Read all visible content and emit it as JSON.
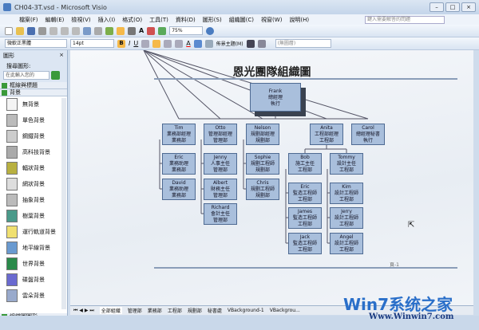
{
  "window": {
    "title": "CH04-3T.vsd - Microsoft Visio"
  },
  "menu": [
    "檔案(F)",
    "編輯(E)",
    "檢視(V)",
    "插入(I)",
    "格式(O)",
    "工具(T)",
    "資料(D)",
    "圖形(S)",
    "組織圖(C)",
    "視窗(W)",
    "說明(H)"
  ],
  "search": {
    "placeholder": "鍵入需要解答的問題"
  },
  "toolbar": {
    "zoom": "75%",
    "font": "微軟正黑體",
    "size": "14pt",
    "theme_label": "佈景主題(M)",
    "layer": "(無圖層)"
  },
  "panel": {
    "title": "圖形",
    "search_label": "搜尋圖形:",
    "search_placeholder": "在此輸入您的",
    "stencils": [
      "框線與標題",
      "背景"
    ],
    "shapes": [
      "無背景",
      "單色背景",
      "鋼鐵背景",
      "高科技背景",
      "輻狀背景",
      "網狀背景",
      "抽象背景",
      "樹葉背景",
      "運行軌道背景",
      "地平線背景",
      "世界背景",
      "碟盤背景",
      "雲朵背景"
    ],
    "bottom_stencil": "組織圖圖形"
  },
  "diagram": {
    "title": "恩光團隊組織圖",
    "page_label": "頁-1",
    "nodes": [
      [
        "Frank",
        "總經理",
        "執行"
      ],
      [
        "Tim",
        "業務部經理",
        "業務部"
      ],
      [
        "Otto",
        "管理部經理",
        "管理部"
      ],
      [
        "Nelson",
        "規劃部經理",
        "規劃部"
      ],
      [
        "Anita",
        "工程部經理",
        "工程部"
      ],
      [
        "Carol",
        "總經理秘書",
        "執行"
      ],
      [
        "Eric",
        "業務助理",
        "業務部"
      ],
      [
        "David",
        "業務助理",
        "業務部"
      ],
      [
        "Jenny",
        "人事主任",
        "管理部"
      ],
      [
        "Albert",
        "財務主任",
        "管理部"
      ],
      [
        "Richard",
        "會計主任",
        "管理部"
      ],
      [
        "Sophie",
        "規劃工程師",
        "規劃部"
      ],
      [
        "Chris",
        "規劃工程師",
        "規劃部"
      ],
      [
        "Bob",
        "施工主任",
        "工程部"
      ],
      [
        "Eric",
        "監造工程師",
        "工程部"
      ],
      [
        "James",
        "監造工程師",
        "工程部"
      ],
      [
        "Jack",
        "監造工程師",
        "工程部"
      ],
      [
        "Tommy",
        "設計主任",
        "工程部"
      ],
      [
        "Kim",
        "設計工程師",
        "工程部"
      ],
      [
        "Jerry",
        "設計工程師",
        "工程部"
      ],
      [
        "Angel",
        "設計工程師",
        "工程部"
      ]
    ]
  },
  "tabs": [
    "全部組織",
    "管理部",
    "業務部",
    "工程部",
    "規劃部",
    "秘書處",
    "VBackground-1",
    "VBackgrou..."
  ],
  "watermark": {
    "brand": "Win7系统之家",
    "url": "Www.Winwin7.com"
  }
}
